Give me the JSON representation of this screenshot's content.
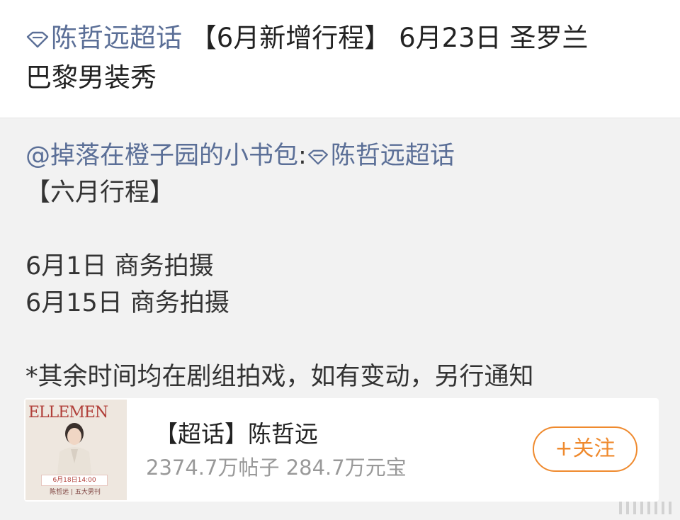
{
  "post": {
    "topic": "陈哲远超话",
    "text_line1": " 【6月新增行程】 6月23日 圣罗兰",
    "text_line2": "巴黎男装秀"
  },
  "repost": {
    "author": "@掉落在橙子园的小书包",
    "separator": ":",
    "topic": "陈哲远超话",
    "lines": [
      "【六月行程】",
      "",
      "6月1日 商务拍摄",
      "6月15日 商务拍摄",
      "",
      "*其余时间均在剧组拍戏，如有变动，另行通知"
    ]
  },
  "card": {
    "title": "【超话】陈哲远",
    "stats": "2374.7万帖子 284.7万元宝",
    "follow_label": "+关注",
    "thumb_masthead": "ELLEMEN",
    "thumb_date": "6月18日14:00",
    "thumb_caption": "陈哲远 | 五大男刊"
  },
  "colors": {
    "link": "#5b6f97",
    "accent": "#ef8a2e",
    "background": "#f2f2f2"
  }
}
